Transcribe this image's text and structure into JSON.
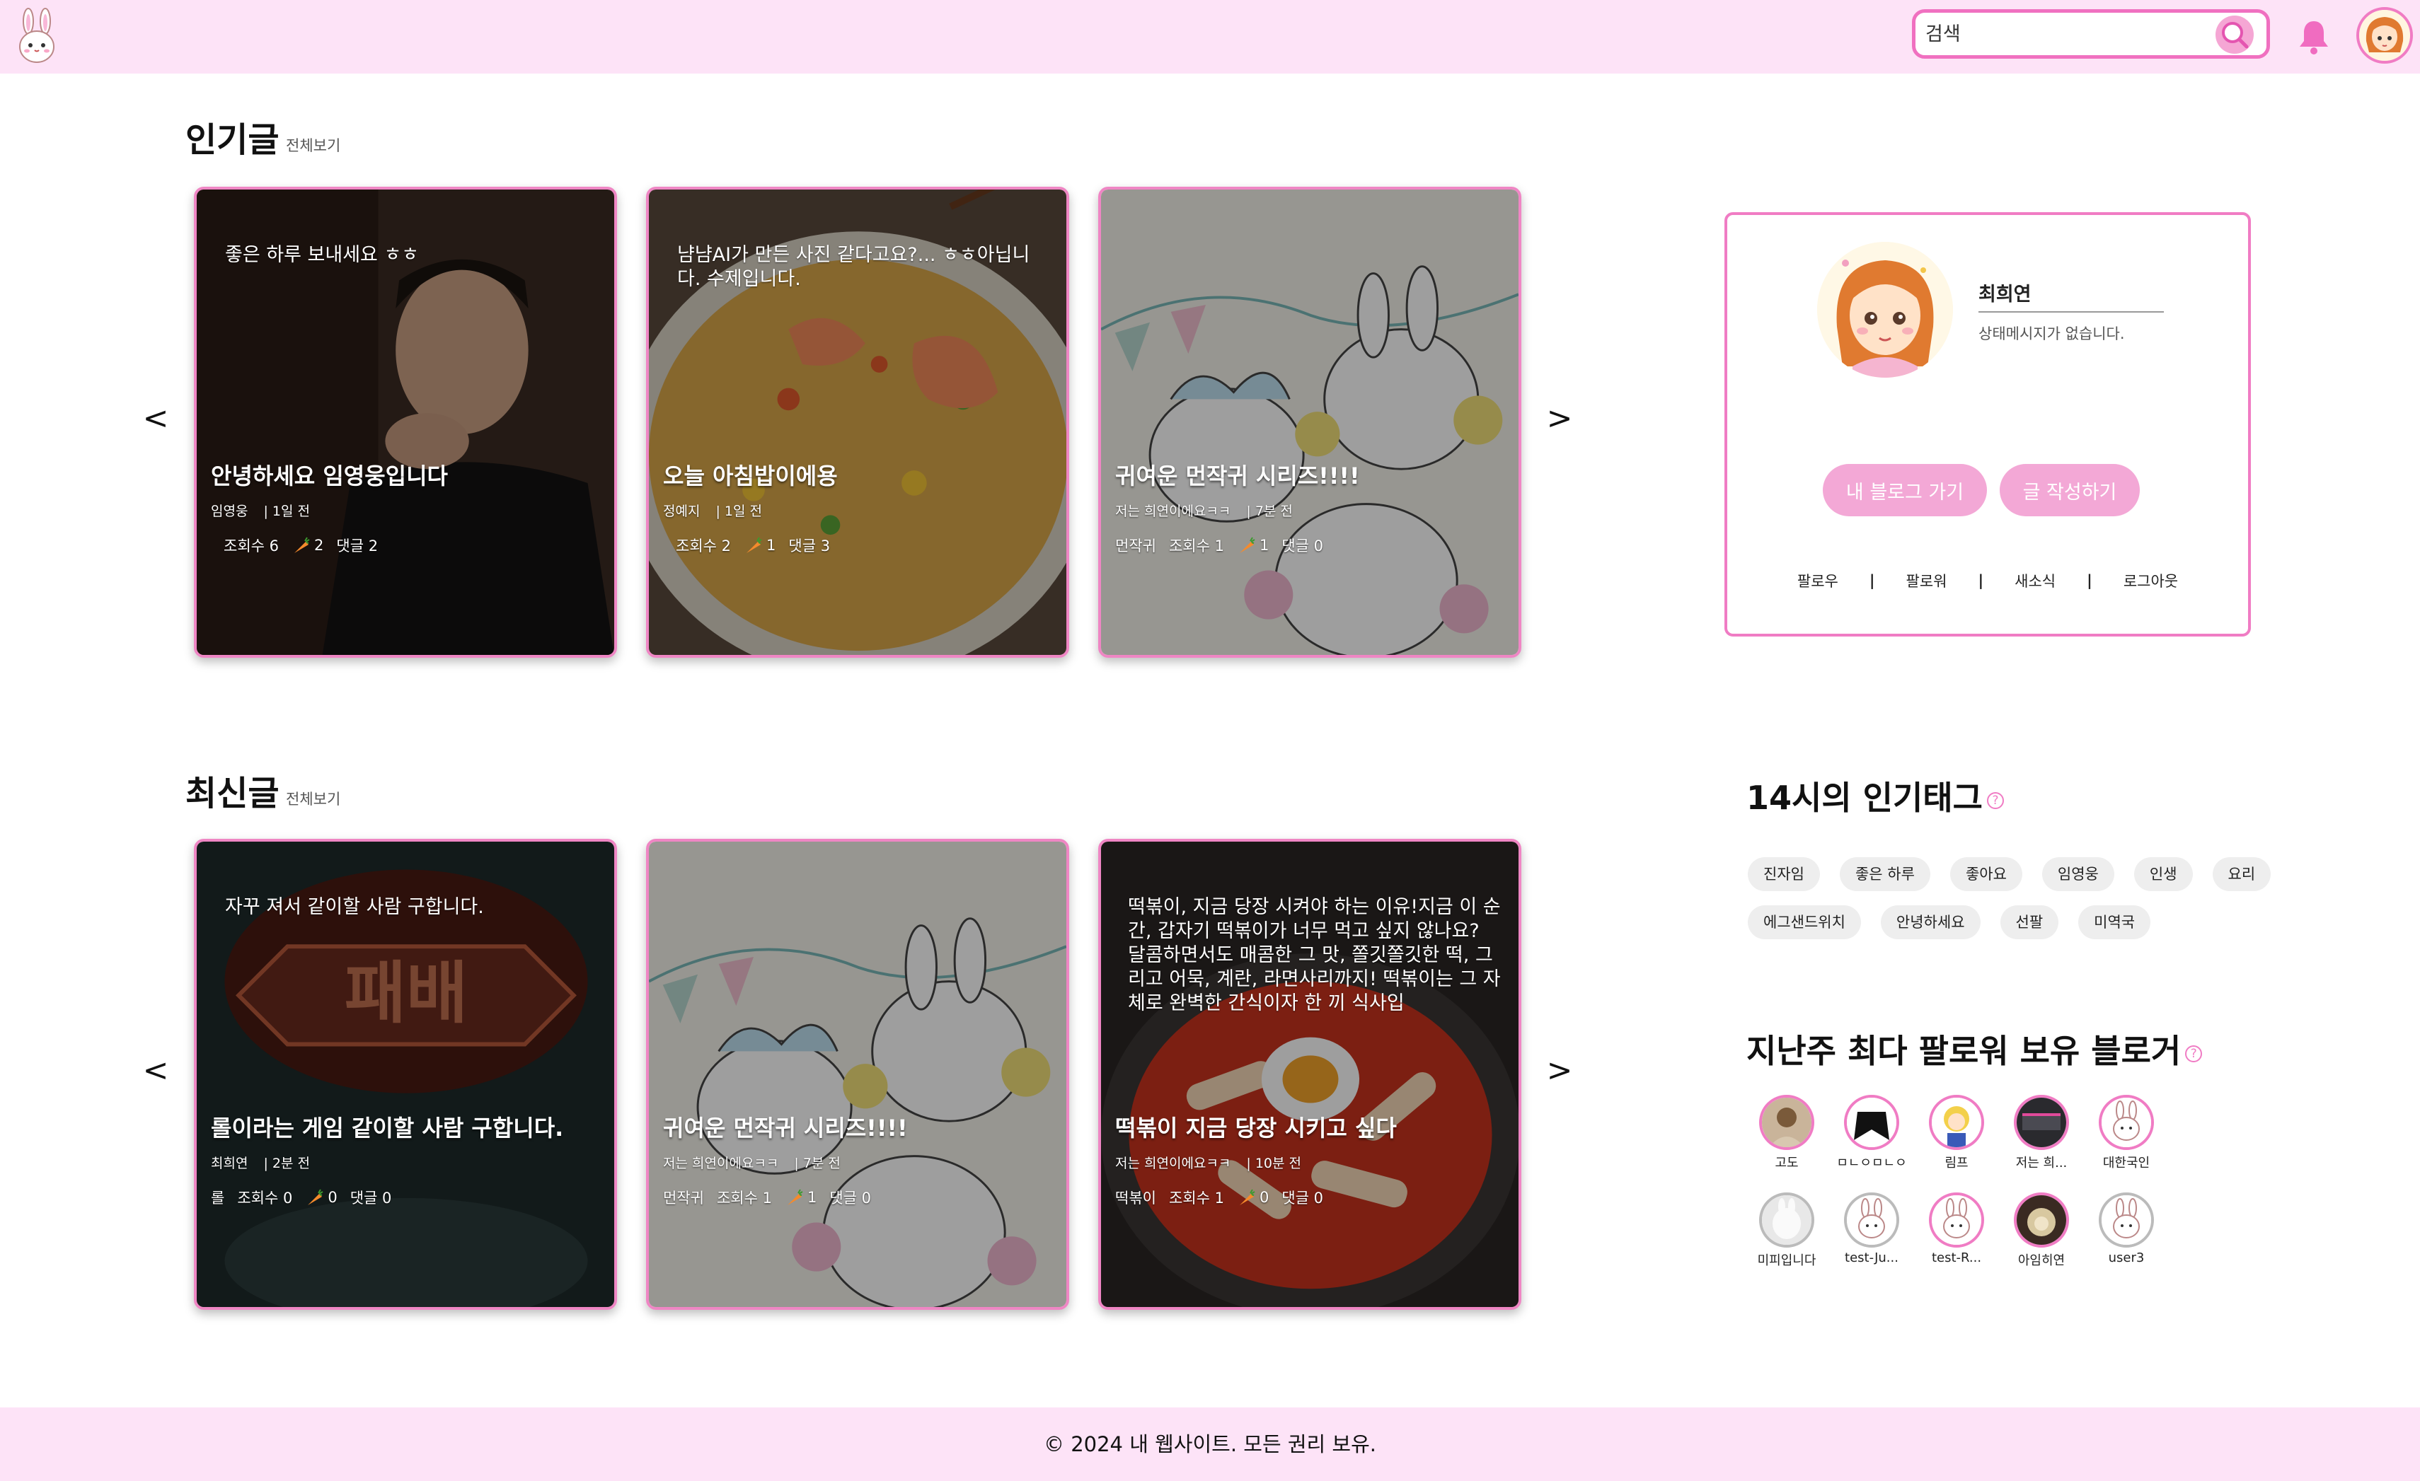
{
  "header": {
    "search_placeholder": "검색"
  },
  "popular": {
    "title": "인기글",
    "view_all": "전체보기",
    "prev": "<",
    "next": ">",
    "cards": [
      {
        "content": "좋은 하루 보내세요 ㅎㅎ",
        "title": "안녕하세요 임영웅입니다",
        "author": "임영웅",
        "time": "| 1일 전",
        "category": "",
        "views": "조회수 6",
        "likes": "2",
        "comments": "댓글 2"
      },
      {
        "content": "냠냠AI가 만든 사진 같다고요?... ㅎㅎ아닙니다. 수제입니다.",
        "title": "오늘 아침밥이에용",
        "author": "정예지",
        "time": "| 1일 전",
        "category": "",
        "views": "조회수 2",
        "likes": "1",
        "comments": "댓글 3"
      },
      {
        "content": "",
        "title": "귀여운 먼작귀 시리즈!!!!",
        "author": "저는 희연이에요ㅋㅋ",
        "time": "| 7분 전",
        "category": "먼작귀",
        "views": "조회수 1",
        "likes": "1",
        "comments": "댓글 0"
      }
    ]
  },
  "latest": {
    "title": "최신글",
    "view_all": "전체보기",
    "prev": "<",
    "next": ">",
    "cards": [
      {
        "content": "자꾸 져서 같이할 사람 구합니다.",
        "title": "롤이라는 게임 같이할 사람 구합니다.",
        "author": "최희연",
        "time": "| 2분 전",
        "category": "롤",
        "views": "조회수 0",
        "likes": "0",
        "comments": "댓글 0"
      },
      {
        "content": "",
        "title": "귀여운 먼작귀 시리즈!!!!",
        "author": "저는 희연이에요ㅋㅋ",
        "time": "| 7분 전",
        "category": "먼작귀",
        "views": "조회수 1",
        "likes": "1",
        "comments": "댓글 0"
      },
      {
        "content": "떡볶이, 지금 당장 시켜야 하는 이유!지금 이 순간, 갑자기 떡볶이가 너무 먹고 싶지 않나요? 달콤하면서도 매콤한 그 맛, 쫄깃쫄깃한 떡, 그리고 어묵, 계란, 라면사리까지! 떡볶이는 그 자체로 완벽한 간식이자 한 끼 식사입",
        "title": "떡볶이 지금 당장 시키고 싶다",
        "author": "저는 희연이에요ㅋㅋ",
        "time": "| 10분 전",
        "category": "떡볶이",
        "views": "조회수 1",
        "likes": "0",
        "comments": "댓글 0"
      }
    ]
  },
  "profile": {
    "name": "최희연",
    "status": "상태메시지가 없습니다.",
    "my_blog_btn": "내 블로그 가기",
    "write_btn": "글 작성하기",
    "links": [
      "팔로우",
      "팔로워",
      "새소식",
      "로그아웃"
    ]
  },
  "tags_section": {
    "title": "14시의 인기태그",
    "help": "?",
    "tags": [
      "진자임",
      "좋은 하루",
      "좋아요",
      "임영웅",
      "인생",
      "요리",
      "에그샌드위치",
      "안녕하세요",
      "선팔",
      "미역국"
    ]
  },
  "bloggers_section": {
    "title": "지난주 최다 팔로워 보유 블로거",
    "help": "?",
    "bloggers": [
      {
        "name": "고도"
      },
      {
        "name": "ㅁㄴㅇㅁㄴㅇ"
      },
      {
        "name": "림프"
      },
      {
        "name": "저는 희..."
      },
      {
        "name": "대한국인"
      },
      {
        "name": "미피입니다"
      },
      {
        "name": "test-Ju..."
      },
      {
        "name": "test-R..."
      },
      {
        "name": "아임히연"
      },
      {
        "name": "user3"
      }
    ]
  },
  "footer": {
    "text": "© 2024 내 웹사이트. 모든 권리 보유."
  },
  "colors": {
    "header_bg": "#fde3f7",
    "accent_pink": "#f07cc4",
    "button_pink": "#f3a8d6"
  }
}
